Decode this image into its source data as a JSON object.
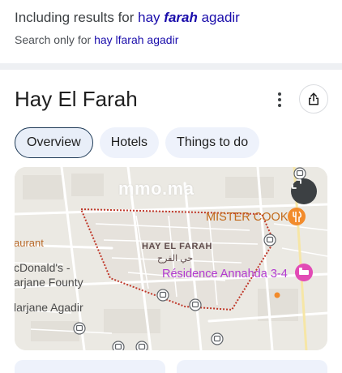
{
  "spelling": {
    "prefix": "Including results for ",
    "corrected_pre": "hay ",
    "corrected_bold": "farah",
    "corrected_post": " agadir",
    "search_only_prefix": "Search only for ",
    "search_only_query": "hay lfarah agadir"
  },
  "header": {
    "title": "Hay El Farah",
    "more_icon": "more-vert-icon",
    "share_icon": "share-icon"
  },
  "tabs": [
    {
      "label": "Overview",
      "active": true
    },
    {
      "label": "Hotels",
      "active": false
    },
    {
      "label": "Things to do",
      "active": false
    }
  ],
  "map": {
    "watermark": "mmo.ma",
    "area_name": "HAY EL FARAH",
    "area_name_ar": "حي الفرح",
    "poi_restaurant": "MISTER COOK",
    "poi_hotel": "Résidence Annahda 3-4",
    "label_aurant": "aurant",
    "label_mcdonalds_1": "cDonald's -",
    "label_mcdonalds_2": "arjane Founty",
    "label_marjane": "larjane Agadir",
    "expand_icon": "expand-icon",
    "colors": {
      "boundary": "#c0392b",
      "restaurant": "#f28b2b",
      "hotel": "#e24bb5",
      "transit": "#5f6368"
    }
  }
}
